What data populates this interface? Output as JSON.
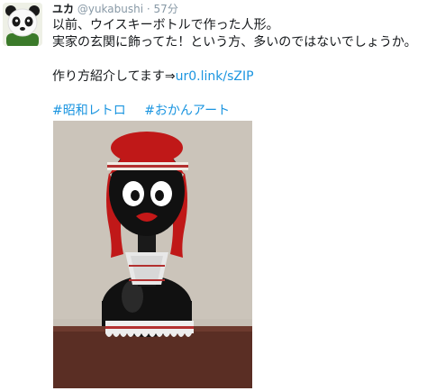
{
  "tweet": {
    "name": "ユカ",
    "handle": "@yukabushi",
    "separator": "·",
    "time": "57分",
    "lines": [
      "以前、ウイスキーボトルで作った人形。",
      "実家の玄関に飾ってた！という方、多いのではないでしょうか。"
    ],
    "link_prefix": "作り方紹介してます⇒",
    "link_text": "ur0.link/sZIP",
    "hashtags": [
      "#昭和レトロ",
      "#おかんアート"
    ]
  },
  "icons": {
    "avatar": "panda-avatar-icon",
    "photo": "whiskey-bottle-doll-photo"
  },
  "colors": {
    "link": "#1b95e0",
    "text": "#14171a",
    "muted": "#8899a6"
  }
}
